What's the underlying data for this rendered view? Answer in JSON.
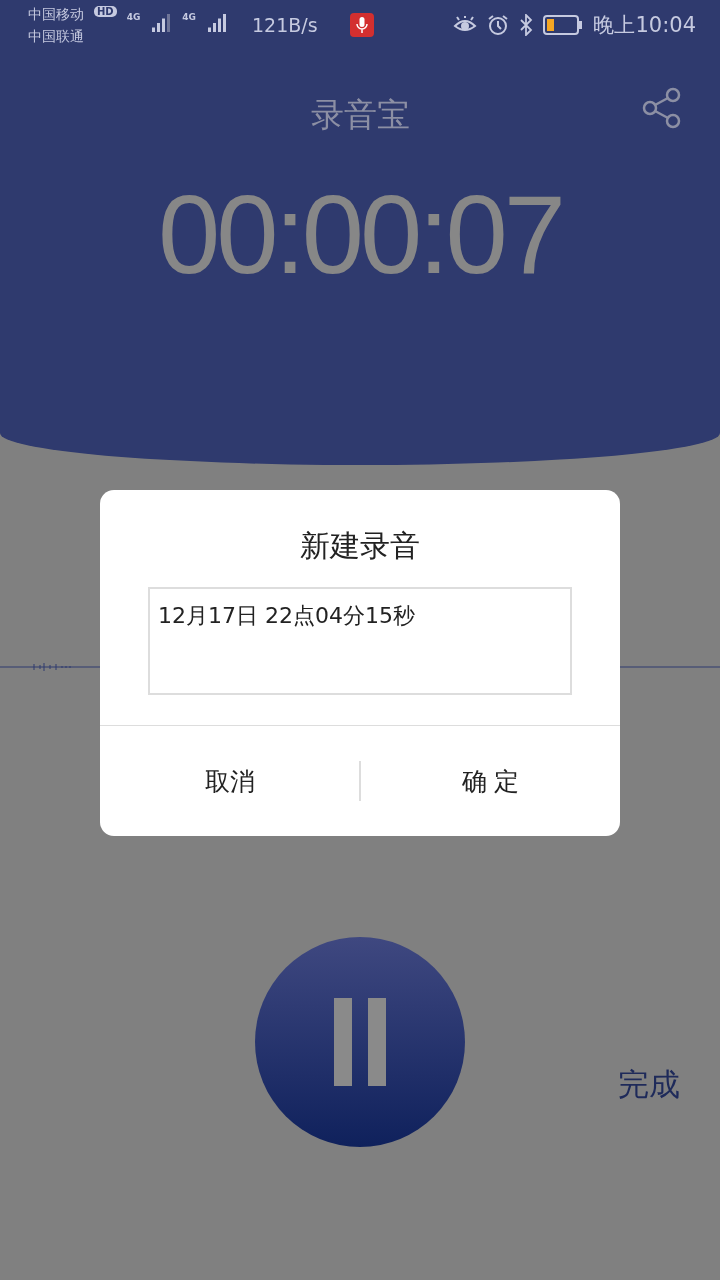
{
  "status_bar": {
    "carriers": [
      "中国移动",
      "中国联通"
    ],
    "hd_badge": "HD",
    "network_types": [
      "4G",
      "4G"
    ],
    "speed": "121B/s",
    "time": "晚上10:04"
  },
  "app": {
    "title": "录音宝",
    "timer": "00:00:07",
    "recording": true,
    "done": "完成"
  },
  "dialog": {
    "title": "新建录音",
    "value": "12月17日 22点04分15秒",
    "buttons": [
      "取消",
      "确 定"
    ]
  }
}
